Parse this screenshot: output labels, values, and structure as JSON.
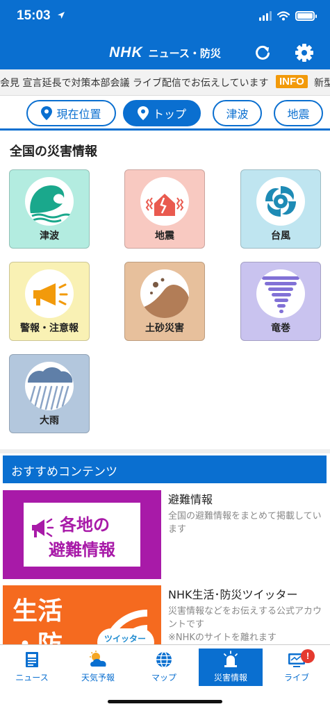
{
  "status_bar": {
    "time": "15:03"
  },
  "header": {
    "brand": "NHK",
    "subtitle": "ニュース・防災"
  },
  "ticker": {
    "text": "会見 宣言延長で対策本部会議 ライブ配信でお伝えしています",
    "badge": "INFO",
    "next": "新型"
  },
  "tabs": [
    {
      "label": "現在位置",
      "icon": "location-pin-icon"
    },
    {
      "label": "トップ",
      "icon": "location-pin-icon",
      "active": true
    },
    {
      "label": "津波"
    },
    {
      "label": "地震"
    }
  ],
  "disaster_section": {
    "title": "全国の災害情報",
    "tiles": [
      {
        "label": "津波",
        "icon": "tsunami-icon",
        "bg": "#b3ece0"
      },
      {
        "label": "地震",
        "icon": "earthquake-icon",
        "bg": "#f8c9c1"
      },
      {
        "label": "台風",
        "icon": "typhoon-icon",
        "bg": "#bfe5f0"
      },
      {
        "label": "警報・注意報",
        "icon": "megaphone-icon",
        "bg": "#f9f1b4"
      },
      {
        "label": "土砂災害",
        "icon": "landslide-icon",
        "bg": "#e7c09c"
      },
      {
        "label": "竜巻",
        "icon": "tornado-icon",
        "bg": "#c9c3ef"
      },
      {
        "label": "大雨",
        "icon": "heavy-rain-icon",
        "bg": "#b3c7dd"
      }
    ]
  },
  "recommended": {
    "title": "おすすめコンテンツ",
    "items": [
      {
        "title": "避難情報",
        "desc": "全国の避難情報をまとめて掲載しています",
        "thumb_text_1": "各地の",
        "thumb_text_2": "避難情報"
      },
      {
        "title": "NHK生活･防災ツイッター",
        "desc": "災害情報などをお伝えする公式アカウントです",
        "note": "※NHKのサイトを離れます",
        "thumb_text_1": "生活",
        "thumb_text_2": "・防",
        "thumb_badge": "ツイッター"
      }
    ]
  },
  "bottom_nav": [
    {
      "label": "ニュース",
      "icon": "newspaper-icon"
    },
    {
      "label": "天気予報",
      "icon": "weather-icon"
    },
    {
      "label": "マップ",
      "icon": "globe-icon"
    },
    {
      "label": "災害情報",
      "icon": "siren-icon",
      "active": true
    },
    {
      "label": "ライブ",
      "icon": "tv-icon",
      "badge": "!"
    }
  ],
  "colors": {
    "primary": "#0a6fd0",
    "info_badge": "#f29a0b",
    "alert_badge": "#e53a2f"
  }
}
